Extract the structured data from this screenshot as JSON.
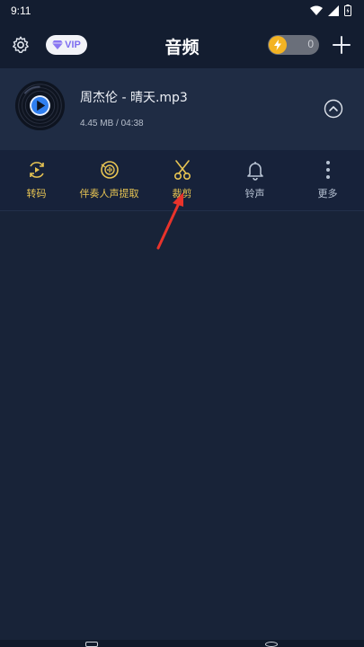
{
  "status_bar": {
    "time": "9:11"
  },
  "header": {
    "settings_icon": "gear-icon",
    "vip_label": "VIP",
    "title": "音频",
    "coin_count": "0",
    "add_icon": "plus-icon"
  },
  "file": {
    "name": "周杰伦 - 晴天.mp3",
    "meta": "4.45 MB / 04:38"
  },
  "actions": [
    {
      "label": "转码",
      "icon": "convert-icon"
    },
    {
      "label": "伴奏人声提取",
      "icon": "vocal-extract-icon"
    },
    {
      "label": "裁剪",
      "icon": "scissors-icon"
    },
    {
      "label": "铃声",
      "icon": "bell-icon"
    },
    {
      "label": "更多",
      "icon": "more-icon"
    }
  ],
  "colors": {
    "background": "#182338",
    "header": "#131d30",
    "card": "#1f2c44",
    "accent_gold": "#e7c453",
    "play_blue": "#2f7ff0",
    "pointer_red": "#e8332b"
  }
}
